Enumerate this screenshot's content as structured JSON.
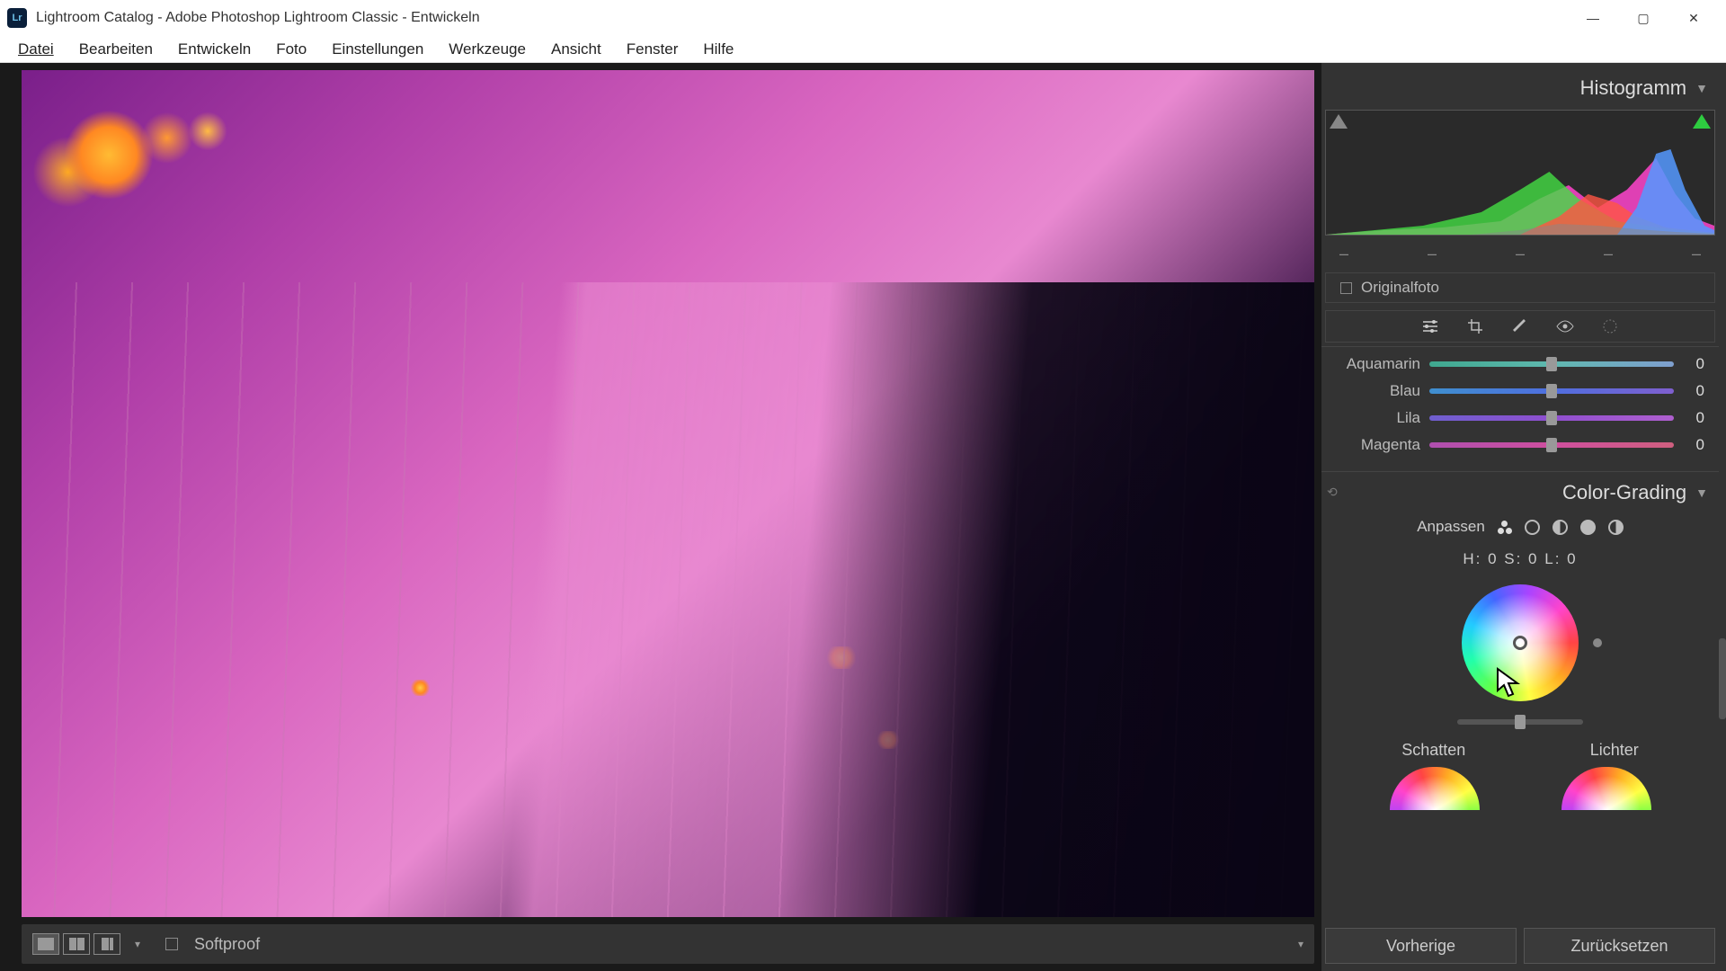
{
  "titlebar": {
    "app_icon": "Lr",
    "title": "Lightroom Catalog - Adobe Photoshop Lightroom Classic - Entwickeln"
  },
  "menu": {
    "items": [
      "Datei",
      "Bearbeiten",
      "Entwickeln",
      "Foto",
      "Einstellungen",
      "Werkzeuge",
      "Ansicht",
      "Fenster",
      "Hilfe"
    ]
  },
  "bottom": {
    "softproof": "Softproof"
  },
  "right": {
    "histogram": {
      "label": "Histogramm"
    },
    "original": {
      "label": "Originalfoto"
    },
    "sliders": [
      {
        "label": "Aquamarin",
        "value": "0",
        "track": "t-aqua"
      },
      {
        "label": "Blau",
        "value": "0",
        "track": "t-blue"
      },
      {
        "label": "Lila",
        "value": "0",
        "track": "t-lila"
      },
      {
        "label": "Magenta",
        "value": "0",
        "track": "t-mag"
      }
    ],
    "color_grading": {
      "label": "Color-Grading",
      "adjust": "Anpassen",
      "hsl": "H: 0 S: 0 L: 0",
      "shadows": "Schatten",
      "lights": "Lichter"
    },
    "actions": {
      "prev": "Vorherige",
      "reset": "Zurücksetzen"
    }
  }
}
